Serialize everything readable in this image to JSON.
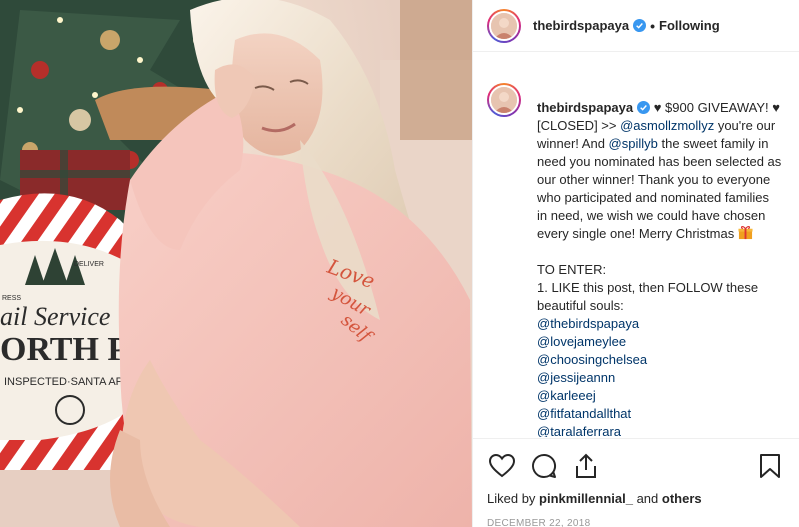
{
  "post": {
    "photo_alt": "",
    "sweatshirt_text": [
      "Love",
      "your",
      "self"
    ],
    "sack_text": [
      "Mail Service",
      "NORTH POLE",
      "INSPECTED · SANTA APPROVED",
      "DELIVER",
      "EXPRESS"
    ]
  },
  "header": {
    "username": "thebirdspapaya",
    "separator": "•",
    "follow_status": "Following"
  },
  "caption": {
    "username": "thebirdspapaya",
    "segments": [
      {
        "t": "text",
        "v": " ♥ $900 GIVEAWAY! ♥ [CLOSED] >> "
      },
      {
        "t": "link",
        "v": "@asmollzmollyz"
      },
      {
        "t": "text",
        "v": " you're our winner! And "
      },
      {
        "t": "link",
        "v": "@spillyb"
      },
      {
        "t": "text",
        "v": " the sweet family in need you nominated has been selected as our other winner! Thank you to everyone who participated and nominated families in need, we wish we could have chosen every single one! Merry Christmas "
      },
      {
        "t": "gift",
        "v": "gift-emoji"
      }
    ],
    "enter_heading": "TO ENTER:",
    "step1": "1. LIKE this post, then FOLLOW these beautiful souls:",
    "accounts": [
      "@thebirdspapaya",
      "@lovejameylee",
      "@choosingchelsea",
      "@jessijeannn",
      "@karleeej",
      "@fitfatandallthat",
      "@taralaferrara"
    ]
  },
  "actions": {
    "icons": [
      "heart-icon",
      "comment-icon",
      "share-icon",
      "bookmark-icon"
    ],
    "liked_by_prefix": "Liked by ",
    "liked_by_user": "pinkmillennial_",
    "liked_by_and": " and ",
    "liked_by_others": "others",
    "date": "DECEMBER 22, 2018"
  },
  "colors": {
    "link": "#003569",
    "verified": "#3897f0",
    "text": "#262626",
    "muted": "#999999",
    "sweatshirt": "#f6c4bc",
    "embroidery": "#d4553d"
  }
}
